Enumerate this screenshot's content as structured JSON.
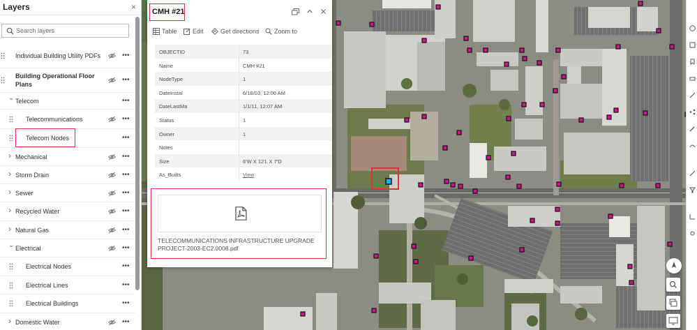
{
  "layers_panel": {
    "title": "Layers",
    "close_glyph": "×",
    "search_placeholder": "Search layers",
    "items": [
      {
        "label": "Individual Building Utility PDFs",
        "bold": false,
        "visibility": "hidden"
      },
      {
        "label": "Building Operational Floor Plans",
        "bold": true,
        "visibility": "hidden"
      },
      {
        "label": "Telecom",
        "expanded": true
      },
      {
        "label": "Telecommunications",
        "visibility": "hidden"
      },
      {
        "label": "Telecom Nodes",
        "highlighted": true
      },
      {
        "label": "Mechanical",
        "visibility": "hidden"
      },
      {
        "label": "Storm Drain",
        "visibility": "hidden"
      },
      {
        "label": "Sewer",
        "visibility": "hidden"
      },
      {
        "label": "Recycled Water",
        "visibility": "hidden"
      },
      {
        "label": "Natural Gas",
        "visibility": "hidden"
      },
      {
        "label": "Electrical",
        "expanded": true,
        "visibility": "hidden"
      },
      {
        "label": "Electrical Nodes"
      },
      {
        "label": "Electrical Lines"
      },
      {
        "label": "Electrical Buildings"
      },
      {
        "label": "Domestic Water",
        "visibility": "hidden"
      }
    ]
  },
  "popup": {
    "title": "CMH #21",
    "actions": [
      "Table",
      "Edit",
      "Get directions",
      "Zoom to"
    ],
    "attributes": [
      {
        "key": "OBJECTID",
        "value": "73"
      },
      {
        "key": "Name",
        "value": "CMH #21"
      },
      {
        "key": "NodeType",
        "value": "1"
      },
      {
        "key": "DateInstal",
        "value": "6/18/03, 12:00 AM"
      },
      {
        "key": "DateLastMa",
        "value": "1/1/11, 12:07 AM"
      },
      {
        "key": "Status",
        "value": "1"
      },
      {
        "key": "Owner",
        "value": "1"
      },
      {
        "key": "Notes",
        "value": ""
      },
      {
        "key": "Size",
        "value": "6'W X 12'L X 7'D"
      },
      {
        "key": "As_Builts",
        "value": "View",
        "link": true
      }
    ],
    "attachment": {
      "icon": "pdf-file-icon",
      "filename": "TELECOMMUNICATIONS INFRASTRUCTURE UPGRADE PROJECT-2003-EC2.0008.pdf"
    }
  },
  "colors": {
    "highlight_box": "#d3353b",
    "node_marker": "#d1138f",
    "selected_marker": "#00b7ff"
  },
  "icons": {
    "drag_handle": "grip-icon",
    "visibility": "eye-off-icon",
    "overflow": "more-horizontal-icon",
    "expand": "chevron-icon",
    "dock": "dock-icon",
    "collapse": "chevron-up-icon",
    "close": "close-icon"
  }
}
